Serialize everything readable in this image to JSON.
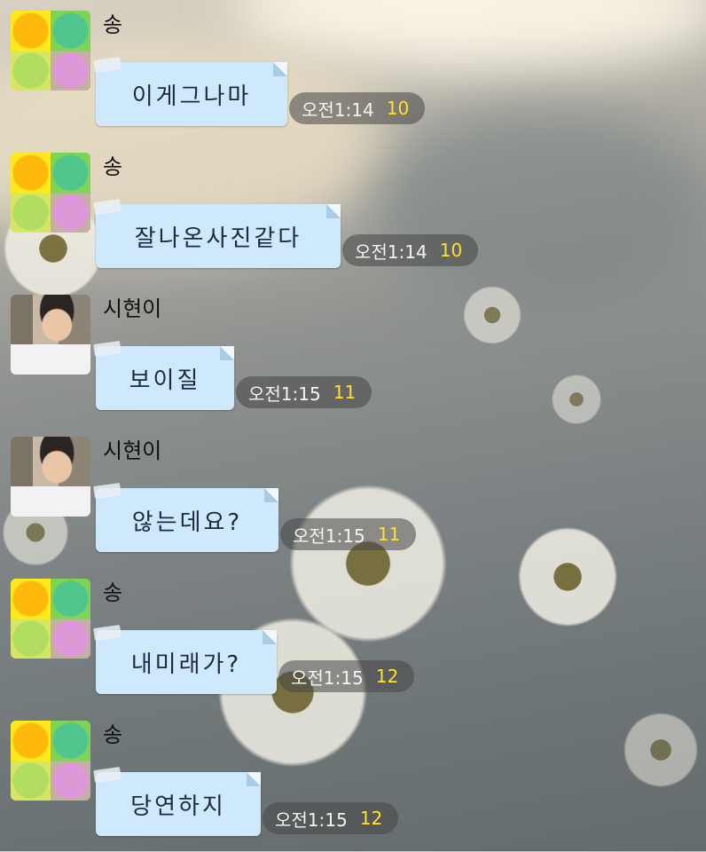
{
  "messages": [
    {
      "sender": "송",
      "text": "이게그나마",
      "time": "오전1:14",
      "count": "10",
      "avatar": "clover-avatar"
    },
    {
      "sender": "송",
      "text": "잘나온사진같다",
      "time": "오전1:14",
      "count": "10",
      "avatar": "clover-avatar"
    },
    {
      "sender": "시현이",
      "text": "보이질",
      "time": "오전1:15",
      "count": "11",
      "avatar": "photo-avatar"
    },
    {
      "sender": "시현이",
      "text": "않는데요?",
      "time": "오전1:15",
      "count": "11",
      "avatar": "photo-avatar"
    },
    {
      "sender": "송",
      "text": "내미래가?",
      "time": "오전1:15",
      "count": "12",
      "avatar": "clover-avatar"
    },
    {
      "sender": "송",
      "text": "당연하지",
      "time": "오전1:15",
      "count": "12",
      "avatar": "clover-avatar"
    }
  ],
  "colors": {
    "bubble": "#cfe9fc",
    "unread_count": "#ffe033"
  }
}
